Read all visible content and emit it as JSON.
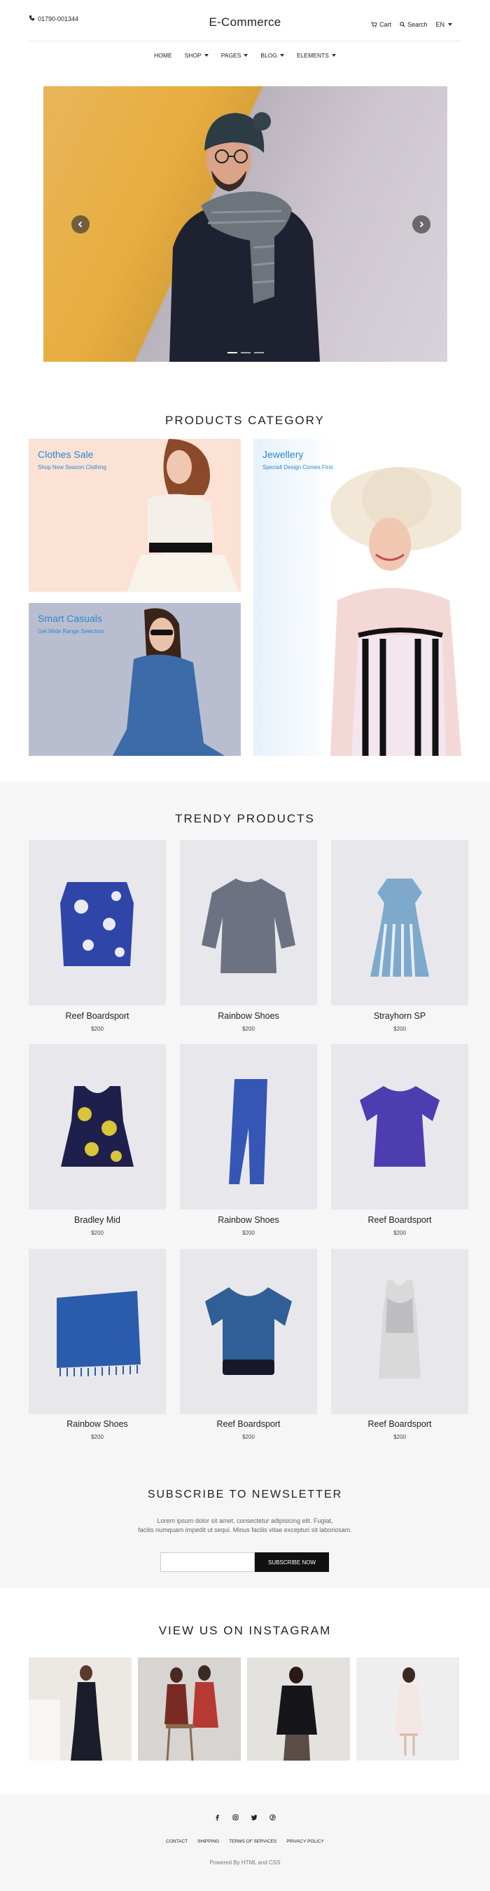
{
  "header": {
    "phone": "01790-001344",
    "logo": "E-Commerce",
    "cart": "Cart",
    "search": "Search",
    "language": "EN"
  },
  "nav": [
    "HOME",
    "SHOP",
    "PAGES",
    "BLOG",
    "ELEMENTS"
  ],
  "slider": {
    "prev_icon": "chevron-left-icon",
    "next_icon": "chevron-right-icon",
    "dots": 3,
    "active_dot": 1
  },
  "categories": {
    "title": "PRODUCTS CATEGORY",
    "items": [
      {
        "title": "Clothes Sale",
        "subtitle": "Shop New Season Clothing"
      },
      {
        "title": "Jewellery",
        "subtitle": "Speciall Design Comes First"
      },
      {
        "title": "Smart Casuals",
        "subtitle": "Get Wide Range Selection"
      }
    ]
  },
  "trendy": {
    "title": "TRENDY PRODUCTS",
    "products": [
      {
        "name": "Reef Boardsport",
        "price": "$200"
      },
      {
        "name": "Rainbow Shoes",
        "price": "$200"
      },
      {
        "name": "Strayhorn SP",
        "price": "$200"
      },
      {
        "name": "Bradley Mid",
        "price": "$200"
      },
      {
        "name": "Rainbow Shoes",
        "price": "$200"
      },
      {
        "name": "Reef Boardsport",
        "price": "$200"
      },
      {
        "name": "Rainbow Shoes",
        "price": "$200"
      },
      {
        "name": "Reef Boardsport",
        "price": "$200"
      },
      {
        "name": "Reef Boardsport",
        "price": "$200"
      }
    ]
  },
  "newsletter": {
    "title": "SUBSCRIBE TO NEWSLETTER",
    "text_line1": "Lorem ipsum dolor sit amet, consectetur adipisicing elit. Fugiat,",
    "text_line2": "facilis numquam impedit ut sequi. Minus facilis vitae excepturi sit laboriosam.",
    "email_placeholder": "",
    "button": "SUBSCRIBE NOW"
  },
  "instagram": {
    "title": "VIEW US ON INSTAGRAM"
  },
  "footer": {
    "social_icons": [
      "facebook-icon",
      "instagram-icon",
      "twitter-icon",
      "pinterest-icon"
    ],
    "links": [
      "CONTACT",
      "SHIPPING",
      "TERMS OF SERVICES",
      "PRIVACY POLICY"
    ],
    "powered": "Powered By HTML and CSS"
  },
  "colors": {
    "accent": "#2b87d1",
    "band": "#f6f6f6",
    "button": "#111111"
  }
}
